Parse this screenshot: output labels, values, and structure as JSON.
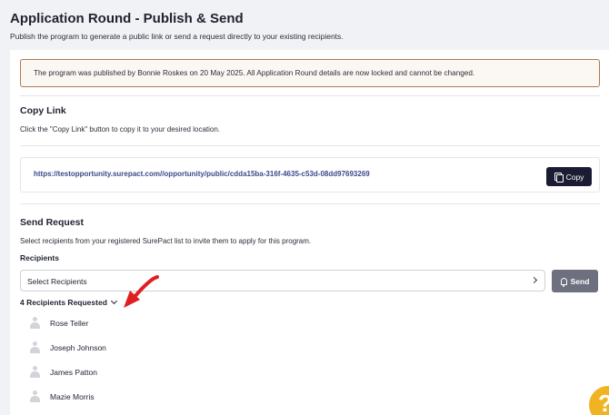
{
  "header": {
    "title": "Application Round - Publish & Send",
    "subtitle": "Publish the program to generate a public link or send a request directly to your existing recipients."
  },
  "notice": {
    "text": "The program was published by Bonnie Roskes on 20 May 2025. All Application Round details are now locked and cannot be changed."
  },
  "copy_link": {
    "title": "Copy Link",
    "description": "Click the \"Copy Link\" button to copy it to your desired location.",
    "url": "https://testopportunity.surepact.com//opportunity/public/cdda15ba-316f-4635-c53d-08dd97693269",
    "button_label": "Copy"
  },
  "send_request": {
    "title": "Send Request",
    "description": "Select recipients from your registered SurePact list to invite them to apply for this program.",
    "field_label": "Recipients",
    "select_value": "Select Recipients",
    "send_label": "Send",
    "requested_label": "4 Recipients Requested",
    "recipients": [
      "Rose Teller",
      "Joseph Johnson",
      "James Patton",
      "Mazie Morris"
    ]
  },
  "help": {
    "icon_glyph": "?"
  },
  "colors": {
    "background": "#f1f2f6",
    "notice_border": "#b07a50",
    "link": "#3b4a8a",
    "copy_button": "#1b1c33",
    "send_button": "#6e6f7f",
    "annotation_arrow": "#e02020",
    "help": "#f0b423"
  }
}
